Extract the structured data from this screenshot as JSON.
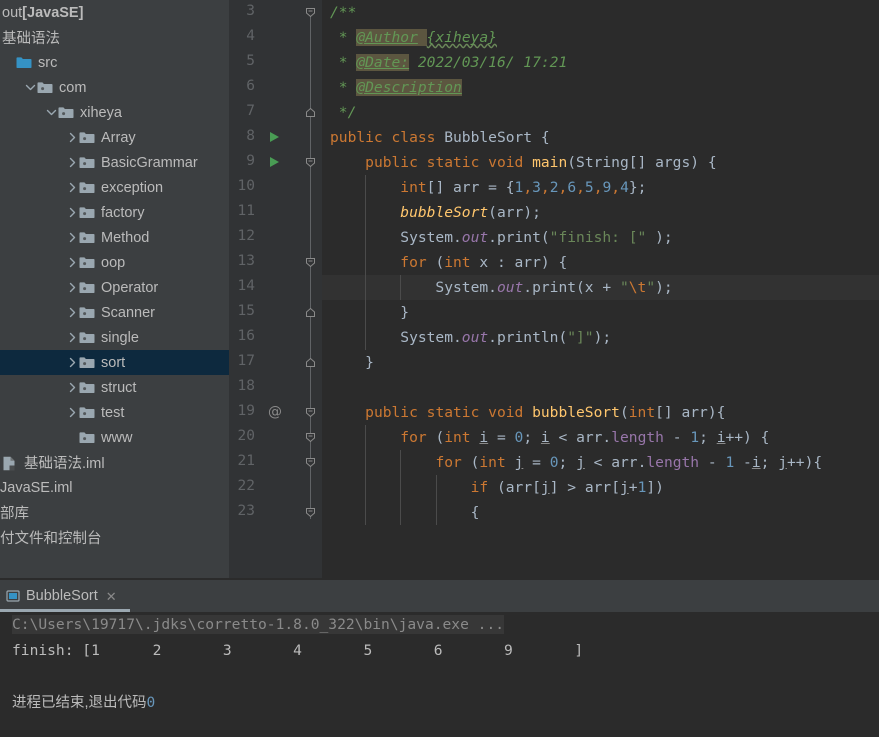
{
  "sidebar": {
    "top_items": [
      {
        "label": "out ",
        "label_bold": "[JavaSE]",
        "icon": "none",
        "indent": 0,
        "twisty": "none",
        "type": "module-out"
      },
      {
        "label": "基础语法",
        "icon": "none",
        "indent": 0,
        "twisty": "none",
        "type": "module"
      }
    ],
    "tree": [
      {
        "label": "src",
        "icon": "source-folder-icon",
        "indent": 0,
        "twisty": "none",
        "selected": false
      },
      {
        "label": "com",
        "icon": "package-icon",
        "indent": 1,
        "twisty": "expanded",
        "selected": false
      },
      {
        "label": "xiheya",
        "icon": "package-icon",
        "indent": 2,
        "twisty": "expanded",
        "selected": false
      },
      {
        "label": "Array",
        "icon": "package-icon",
        "indent": 3,
        "twisty": "collapsed",
        "selected": false
      },
      {
        "label": "BasicGrammar",
        "icon": "package-icon",
        "indent": 3,
        "twisty": "collapsed",
        "selected": false
      },
      {
        "label": "exception",
        "icon": "package-icon",
        "indent": 3,
        "twisty": "collapsed",
        "selected": false
      },
      {
        "label": "factory",
        "icon": "package-icon",
        "indent": 3,
        "twisty": "collapsed",
        "selected": false
      },
      {
        "label": "Method",
        "icon": "package-icon",
        "indent": 3,
        "twisty": "collapsed",
        "selected": false
      },
      {
        "label": "oop",
        "icon": "package-icon",
        "indent": 3,
        "twisty": "collapsed",
        "selected": false
      },
      {
        "label": "Operator",
        "icon": "package-icon",
        "indent": 3,
        "twisty": "collapsed",
        "selected": false
      },
      {
        "label": "Scanner",
        "icon": "package-icon",
        "indent": 3,
        "twisty": "collapsed",
        "selected": false
      },
      {
        "label": "single",
        "icon": "package-icon",
        "indent": 3,
        "twisty": "collapsed",
        "selected": false
      },
      {
        "label": "sort",
        "icon": "package-icon",
        "indent": 3,
        "twisty": "collapsed",
        "selected": true
      },
      {
        "label": "struct",
        "icon": "package-icon",
        "indent": 3,
        "twisty": "collapsed",
        "selected": false
      },
      {
        "label": "test",
        "icon": "package-icon",
        "indent": 3,
        "twisty": "collapsed",
        "selected": false
      },
      {
        "label": "www",
        "icon": "package-icon",
        "indent": 3,
        "twisty": "none",
        "selected": false
      }
    ],
    "bottom_items": [
      {
        "label": "基础语法.iml",
        "icon": "iml-file-icon",
        "clipped": false
      },
      {
        "label": "JavaSE.iml",
        "icon": "none",
        "clipped": true
      },
      {
        "label": "部库",
        "icon": "none",
        "clipped": true
      },
      {
        "label": "付文件和控制台",
        "icon": "none",
        "clipped": true
      }
    ],
    "selection_color": "#0d293e"
  },
  "editor": {
    "lines": [
      {
        "num": "3",
        "run": false,
        "at": false,
        "fold": "start-doc",
        "caret": false,
        "indent_guides": [],
        "tokens": [
          {
            "t": "/**",
            "c": "doc"
          }
        ],
        "pad": 0
      },
      {
        "num": "4",
        "run": false,
        "at": false,
        "fold": "body",
        "caret": false,
        "indent_guides": [],
        "tokens": [
          {
            "t": " * ",
            "c": "doc"
          },
          {
            "t": "@Author",
            "c": "tag"
          },
          {
            "t": " ",
            "c": "tagw"
          },
          {
            "t": "{xiheya}",
            "c": "doc typo"
          }
        ],
        "pad": 0
      },
      {
        "num": "5",
        "run": false,
        "at": false,
        "fold": "body",
        "caret": false,
        "indent_guides": [],
        "tokens": [
          {
            "t": " * ",
            "c": "doc"
          },
          {
            "t": "@Date:",
            "c": "tag"
          },
          {
            "t": " 2022/03/16/ 17:21",
            "c": "doc"
          }
        ],
        "pad": 0
      },
      {
        "num": "6",
        "run": false,
        "at": false,
        "fold": "body",
        "caret": false,
        "indent_guides": [],
        "tokens": [
          {
            "t": " * ",
            "c": "doc"
          },
          {
            "t": "@Description",
            "c": "tag"
          }
        ],
        "pad": 0
      },
      {
        "num": "7",
        "run": false,
        "at": false,
        "fold": "end-doc",
        "caret": false,
        "indent_guides": [],
        "tokens": [
          {
            "t": " */",
            "c": "doc"
          }
        ],
        "pad": 0
      },
      {
        "num": "8",
        "run": true,
        "at": false,
        "fold": "none",
        "caret": false,
        "indent_guides": [],
        "tokens": [
          {
            "t": "public class ",
            "c": "k"
          },
          {
            "t": "BubbleSort",
            "c": ""
          },
          {
            "t": " {",
            "c": ""
          }
        ],
        "pad": 0
      },
      {
        "num": "9",
        "run": true,
        "at": false,
        "fold": "start",
        "caret": false,
        "indent_guides": [],
        "tokens": [
          {
            "t": "    ",
            "c": ""
          },
          {
            "t": "public static void ",
            "c": "k"
          },
          {
            "t": "main",
            "c": "f"
          },
          {
            "t": "(String[] args) {",
            "c": ""
          }
        ],
        "pad": 0
      },
      {
        "num": "10",
        "run": false,
        "at": false,
        "fold": "body",
        "caret": false,
        "indent_guides": [
          1
        ],
        "tokens": [
          {
            "t": "        ",
            "c": ""
          },
          {
            "t": "int",
            "c": "k"
          },
          {
            "t": "[] arr = {",
            "c": ""
          },
          {
            "t": "1",
            "c": "n"
          },
          {
            "t": ",",
            "c": "sep"
          },
          {
            "t": "3",
            "c": "n"
          },
          {
            "t": ",",
            "c": "sep"
          },
          {
            "t": "2",
            "c": "n"
          },
          {
            "t": ",",
            "c": "sep"
          },
          {
            "t": "6",
            "c": "n"
          },
          {
            "t": ",",
            "c": "sep"
          },
          {
            "t": "5",
            "c": "n"
          },
          {
            "t": ",",
            "c": "sep"
          },
          {
            "t": "9",
            "c": "n"
          },
          {
            "t": ",",
            "c": "sep"
          },
          {
            "t": "4",
            "c": "n"
          },
          {
            "t": "};",
            "c": ""
          }
        ],
        "pad": 0
      },
      {
        "num": "11",
        "run": false,
        "at": false,
        "fold": "body",
        "caret": false,
        "indent_guides": [
          1
        ],
        "tokens": [
          {
            "t": "        ",
            "c": ""
          },
          {
            "t": "bubbleSort",
            "c": "sm"
          },
          {
            "t": "(arr);",
            "c": ""
          }
        ],
        "pad": 0
      },
      {
        "num": "12",
        "run": false,
        "at": false,
        "fold": "body",
        "caret": false,
        "indent_guides": [
          1
        ],
        "tokens": [
          {
            "t": "        System.",
            "c": ""
          },
          {
            "t": "out",
            "c": "fld"
          },
          {
            "t": ".print(",
            "c": ""
          },
          {
            "t": "\"finish: [\"",
            "c": "s"
          },
          {
            "t": " );",
            "c": ""
          }
        ],
        "pad": 0
      },
      {
        "num": "13",
        "run": false,
        "at": false,
        "fold": "start",
        "caret": false,
        "indent_guides": [
          1
        ],
        "tokens": [
          {
            "t": "        ",
            "c": ""
          },
          {
            "t": "for",
            "c": "k"
          },
          {
            "t": " (",
            "c": ""
          },
          {
            "t": "int",
            "c": "k"
          },
          {
            "t": " x : arr) {",
            "c": ""
          }
        ],
        "pad": 0
      },
      {
        "num": "14",
        "run": false,
        "at": false,
        "fold": "body",
        "caret": true,
        "indent_guides": [
          1,
          2
        ],
        "tokens": [
          {
            "t": "            System.",
            "c": ""
          },
          {
            "t": "out",
            "c": "fld"
          },
          {
            "t": ".print(x + ",
            "c": ""
          },
          {
            "t": "\"",
            "c": "s"
          },
          {
            "t": "\\t",
            "c": "esc"
          },
          {
            "t": "\"",
            "c": "s"
          },
          {
            "t": ");",
            "c": ""
          }
        ],
        "pad": 0
      },
      {
        "num": "15",
        "run": false,
        "at": false,
        "fold": "end",
        "caret": false,
        "indent_guides": [
          1
        ],
        "tokens": [
          {
            "t": "        }",
            "c": ""
          }
        ],
        "pad": 0
      },
      {
        "num": "16",
        "run": false,
        "at": false,
        "fold": "body",
        "caret": false,
        "indent_guides": [
          1
        ],
        "tokens": [
          {
            "t": "        System.",
            "c": ""
          },
          {
            "t": "out",
            "c": "fld"
          },
          {
            "t": ".println(",
            "c": ""
          },
          {
            "t": "\"]\"",
            "c": "s"
          },
          {
            "t": ");",
            "c": ""
          }
        ],
        "pad": 0
      },
      {
        "num": "17",
        "run": false,
        "at": false,
        "fold": "end",
        "caret": false,
        "indent_guides": [],
        "tokens": [
          {
            "t": "    }",
            "c": ""
          }
        ],
        "pad": 0
      },
      {
        "num": "18",
        "run": false,
        "at": false,
        "fold": "none",
        "caret": false,
        "indent_guides": [],
        "tokens": [],
        "pad": 0
      },
      {
        "num": "19",
        "run": false,
        "at": true,
        "fold": "start",
        "caret": false,
        "indent_guides": [],
        "tokens": [
          {
            "t": "    ",
            "c": ""
          },
          {
            "t": "public static void ",
            "c": "k"
          },
          {
            "t": "bubbleSort",
            "c": "f"
          },
          {
            "t": "(",
            "c": ""
          },
          {
            "t": "int",
            "c": "k"
          },
          {
            "t": "[] arr){",
            "c": ""
          }
        ],
        "pad": 0
      },
      {
        "num": "20",
        "run": false,
        "at": false,
        "fold": "start",
        "caret": false,
        "indent_guides": [
          1
        ],
        "tokens": [
          {
            "t": "        ",
            "c": ""
          },
          {
            "t": "for",
            "c": "k"
          },
          {
            "t": " (",
            "c": ""
          },
          {
            "t": "int",
            "c": "k"
          },
          {
            "t": " ",
            "c": ""
          },
          {
            "t": "i",
            "c": "sq"
          },
          {
            "t": " = ",
            "c": ""
          },
          {
            "t": "0",
            "c": "n"
          },
          {
            "t": "; ",
            "c": ""
          },
          {
            "t": "i",
            "c": "sq"
          },
          {
            "t": " < arr.",
            "c": ""
          },
          {
            "t": "length",
            "c": "p"
          },
          {
            "t": " - ",
            "c": ""
          },
          {
            "t": "1",
            "c": "n"
          },
          {
            "t": "; ",
            "c": ""
          },
          {
            "t": "i",
            "c": "sq"
          },
          {
            "t": "++) {",
            "c": ""
          }
        ],
        "pad": 0
      },
      {
        "num": "21",
        "run": false,
        "at": false,
        "fold": "start",
        "caret": false,
        "indent_guides": [
          1,
          2
        ],
        "tokens": [
          {
            "t": "            ",
            "c": ""
          },
          {
            "t": "for",
            "c": "k"
          },
          {
            "t": " (",
            "c": ""
          },
          {
            "t": "int",
            "c": "k"
          },
          {
            "t": " ",
            "c": ""
          },
          {
            "t": "j",
            "c": "sq"
          },
          {
            "t": " = ",
            "c": ""
          },
          {
            "t": "0",
            "c": "n"
          },
          {
            "t": "; ",
            "c": ""
          },
          {
            "t": "j",
            "c": "sq"
          },
          {
            "t": " < arr.",
            "c": ""
          },
          {
            "t": "length",
            "c": "p"
          },
          {
            "t": " - ",
            "c": ""
          },
          {
            "t": "1",
            "c": "n"
          },
          {
            "t": " -",
            "c": ""
          },
          {
            "t": "i",
            "c": "sq"
          },
          {
            "t": "; ",
            "c": ""
          },
          {
            "t": "j",
            "c": "sq"
          },
          {
            "t": "++){",
            "c": ""
          }
        ],
        "pad": 0
      },
      {
        "num": "22",
        "run": false,
        "at": false,
        "fold": "body",
        "caret": false,
        "indent_guides": [
          1,
          2,
          3
        ],
        "tokens": [
          {
            "t": "                ",
            "c": ""
          },
          {
            "t": "if",
            "c": "k"
          },
          {
            "t": " (arr[",
            "c": ""
          },
          {
            "t": "j",
            "c": "sq"
          },
          {
            "t": "] > arr[",
            "c": ""
          },
          {
            "t": "j",
            "c": "sq"
          },
          {
            "t": "+",
            "c": ""
          },
          {
            "t": "1",
            "c": "n"
          },
          {
            "t": "])",
            "c": ""
          }
        ],
        "pad": 0
      },
      {
        "num": "23",
        "run": false,
        "at": false,
        "fold": "start",
        "caret": false,
        "indent_guides": [
          1,
          2,
          3
        ],
        "tokens": [
          {
            "t": "                {",
            "c": ""
          }
        ],
        "pad": 0
      }
    ]
  },
  "console_panel": {
    "tab": {
      "label": "BubbleSort",
      "close_glyph": "✕",
      "icon": "console-run-icon"
    },
    "lines": [
      {
        "type": "cmd",
        "text": "C:\\Users\\19717\\.jdks\\corretto-1.8.0_322\\bin\\java.exe ..."
      },
      {
        "type": "out",
        "text": "finish: [1\t2\t3\t4\t5\t6\t9\t]"
      },
      {
        "type": "blank",
        "text": ""
      },
      {
        "type": "exit",
        "text": "进程已结束,退出代码",
        "code": "0"
      }
    ]
  },
  "colors": {
    "editor_bg": "#2b2b2b",
    "gutter_bg": "#313335",
    "panel_bg": "#3c3f41",
    "caret_line": "#323232",
    "selection": "#0d293e",
    "keyword": "#cc7832",
    "string": "#6a8759",
    "number": "#6897bb",
    "method": "#ffc66d",
    "field": "#9876aa",
    "doc": "#629755",
    "text": "#a9b7c6",
    "run_green": "#499c54"
  }
}
